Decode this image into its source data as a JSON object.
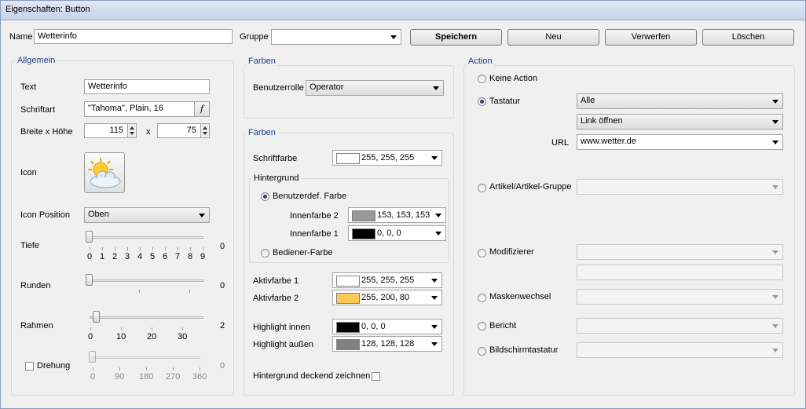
{
  "window": {
    "title": "Eigenschaften: Button"
  },
  "top": {
    "name_label": "Name",
    "name_value": "Wetterinfo",
    "gruppe_label": "Gruppe",
    "gruppe_value": "",
    "buttons": {
      "save": "Speichern",
      "new": "Neu",
      "discard": "Verwerfen",
      "delete": "Löschen"
    }
  },
  "allgemein": {
    "title": "Allgemein",
    "text_label": "Text",
    "text_value": "Wetterinfo",
    "font_label": "Schriftart",
    "font_value": "\"Tahoma\", Plain, 16",
    "font_button": "f",
    "size_label": "Breite x Höhe",
    "width": "115",
    "times": "x",
    "height": "75",
    "icon_label": "Icon",
    "icon_name": "weather-sun-cloud-icon",
    "icon_pos_label": "Icon Position",
    "icon_pos_value": "Oben",
    "tiefe": {
      "label": "Tiefe",
      "value": "0",
      "level": 0,
      "ticks": [
        "0",
        "1",
        "2",
        "3",
        "4",
        "5",
        "6",
        "7",
        "8",
        "9"
      ]
    },
    "runden": {
      "label": "Runden",
      "value": "0",
      "level": 0
    },
    "rahmen": {
      "label": "Rahmen",
      "value": "2",
      "level": 2,
      "ticks": [
        "0",
        "10",
        "20",
        "30"
      ]
    },
    "drehung": {
      "label": "Drehung",
      "value": "0",
      "level": 0,
      "checked": false,
      "ticks": [
        "0",
        "90",
        "180",
        "270",
        "360"
      ]
    }
  },
  "farben1": {
    "title": "Farben",
    "role_label": "Benutzerrolle",
    "role_value": "Operator"
  },
  "farben2": {
    "title": "Farben",
    "font_color_label": "Schriftfarbe",
    "font_color_value": "255, 255, 255",
    "font_color_hex": "#ffffff",
    "bg_title": "Hintergrund",
    "custom_label": "Benutzerdef. Farbe",
    "custom_checked": true,
    "inner2_label": "Innenfarbe 2",
    "inner2_value": "153, 153, 153",
    "inner2_hex": "#999999",
    "inner1_label": "Innenfarbe 1",
    "inner1_value": "0, 0, 0",
    "inner1_hex": "#000000",
    "operator_color_label": "Bediener-Farbe",
    "active1_label": "Aktivfarbe 1",
    "active1_value": "255, 255, 255",
    "active1_hex": "#ffffff",
    "active2_label": "Aktivfarbe 2",
    "active2_value": "255, 200, 80",
    "active2_hex": "#ffc850",
    "hl_in_label": "Highlight innen",
    "hl_in_value": "0, 0, 0",
    "hl_in_hex": "#000000",
    "hl_out_label": "Highlight außen",
    "hl_out_value": "128, 128, 128",
    "hl_out_hex": "#808080",
    "opaque_label": "Hintergrund deckend zeichnen",
    "opaque_checked": false
  },
  "action": {
    "title": "Action",
    "none_label": "Keine Action",
    "keyboard_label": "Tastatur",
    "keyboard_value1": "Alle",
    "keyboard_value2": "Link öffnen",
    "url_label": "URL",
    "url_value": "www.wetter.de",
    "article_label": "Artikel/Artikel-Gruppe",
    "modifier_label": "Modifizierer",
    "mask_label": "Maskenwechsel",
    "report_label": "Bericht",
    "screen_kb_label": "Bildschirmtastatur",
    "selected": "Tastatur"
  }
}
